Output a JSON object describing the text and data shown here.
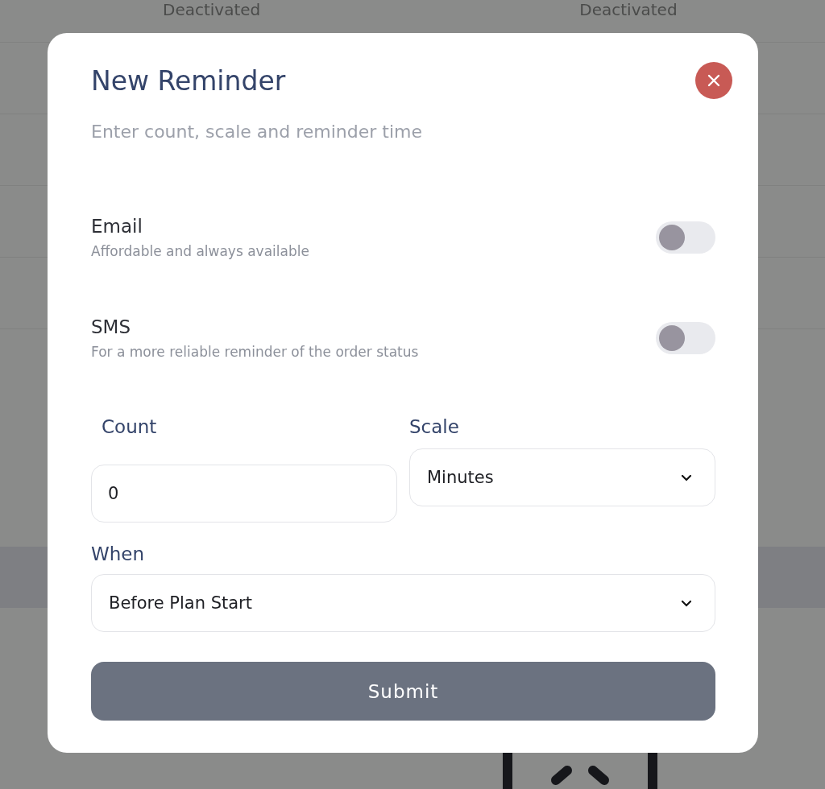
{
  "background": {
    "status_cells": [
      "Deactivated",
      "Deactivated"
    ]
  },
  "dialog": {
    "title": "New Reminder",
    "subtitle": "Enter count, scale and reminder time",
    "channels": [
      {
        "name": "Email",
        "description": "Affordable and always available",
        "on": false
      },
      {
        "name": "SMS",
        "description": "For a more reliable reminder of the order status",
        "on": false
      }
    ],
    "count": {
      "label": "Count",
      "value": "0"
    },
    "scale": {
      "label": "Scale",
      "value": "Minutes"
    },
    "when": {
      "label": "When",
      "value": "Before Plan Start"
    },
    "submit": "Submit"
  }
}
